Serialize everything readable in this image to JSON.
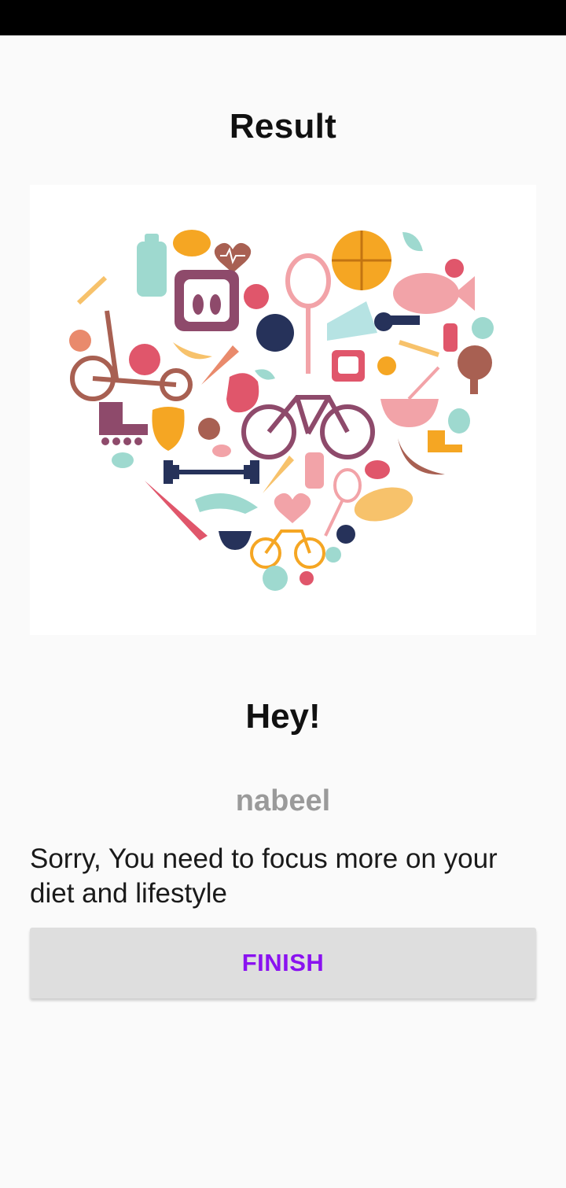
{
  "screen": {
    "title": "Result",
    "greeting": "Hey!",
    "username": "nabeel",
    "message": "Sorry, You need to focus more on your diet and lifestyle",
    "finish_label": "FINISH"
  },
  "illustration": {
    "subject": "heart-shaped collage of fitness and healthy food icons",
    "palette": [
      "#9ed9cf",
      "#f5a623",
      "#e0566b",
      "#8e4a6b",
      "#26325a",
      "#f7c26b",
      "#a86052"
    ]
  },
  "colors": {
    "background": "#fafafa",
    "status_bar": "#000000",
    "button_bg": "#dedede",
    "button_text": "#8a12f0",
    "username_text": "#9a9a9a"
  }
}
